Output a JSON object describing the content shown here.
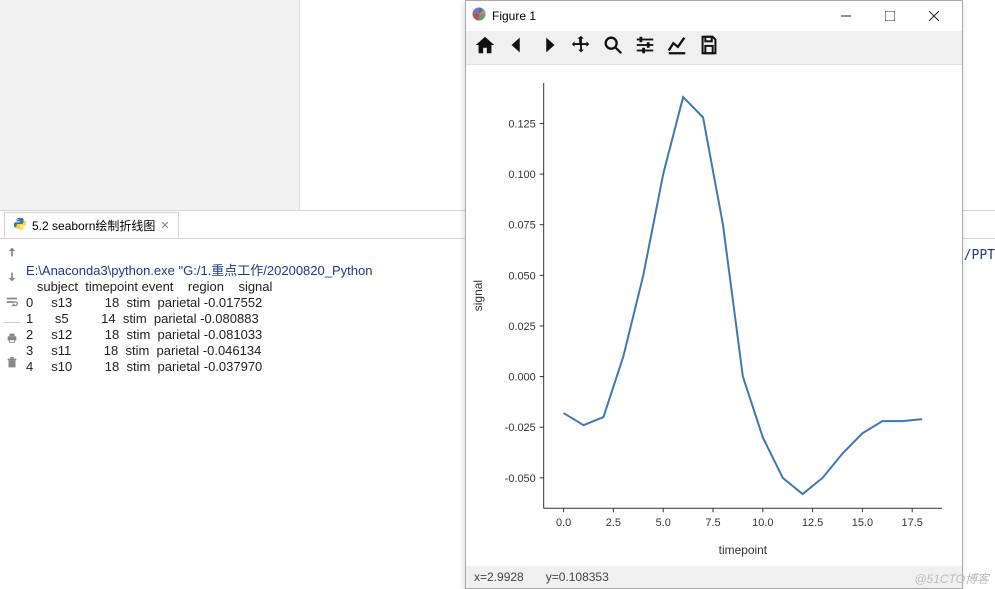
{
  "ide": {
    "tab_label": "5.2 seaborn绘制折线图",
    "command_line": "E:\\Anaconda3\\python.exe \"G:/1.重点工作/20200820_Python",
    "path_tail": "/PPT",
    "table_header": "   subject  timepoint event    region    signal",
    "rows": [
      "0     s13         18  stim  parietal -0.017552",
      "1      s5         14  stim  parietal -0.080883",
      "2     s12         18  stim  parietal -0.081033",
      "3     s11         18  stim  parietal -0.046134",
      "4     s10         18  stim  parietal -0.037970"
    ]
  },
  "figure": {
    "title": "Figure 1",
    "status_x": "x=2.9928",
    "status_y": "y=0.108353",
    "xlabel": "timepoint",
    "ylabel": "signal",
    "xticks": [
      "0.0",
      "2.5",
      "5.0",
      "7.5",
      "10.0",
      "12.5",
      "15.0",
      "17.5"
    ],
    "yticks": [
      "-0.050",
      "-0.025",
      "0.000",
      "0.025",
      "0.050",
      "0.075",
      "0.100",
      "0.125"
    ]
  },
  "chart_data": {
    "type": "line",
    "title": "",
    "xlabel": "timepoint",
    "ylabel": "signal",
    "xlim": [
      -1,
      19
    ],
    "ylim": [
      -0.065,
      0.145
    ],
    "x": [
      0,
      1,
      2,
      3,
      4,
      5,
      6,
      7,
      8,
      9,
      10,
      11,
      12,
      13,
      14,
      15,
      16,
      17,
      18
    ],
    "y": [
      -0.018,
      -0.024,
      -0.02,
      0.01,
      0.05,
      0.1,
      0.138,
      0.128,
      0.075,
      0.0,
      -0.03,
      -0.05,
      -0.058,
      -0.05,
      -0.038,
      -0.028,
      -0.022,
      -0.022,
      -0.021
    ],
    "series": [
      {
        "name": "signal",
        "color": "#3d78b4"
      }
    ]
  },
  "watermark": "@51CTO博客"
}
